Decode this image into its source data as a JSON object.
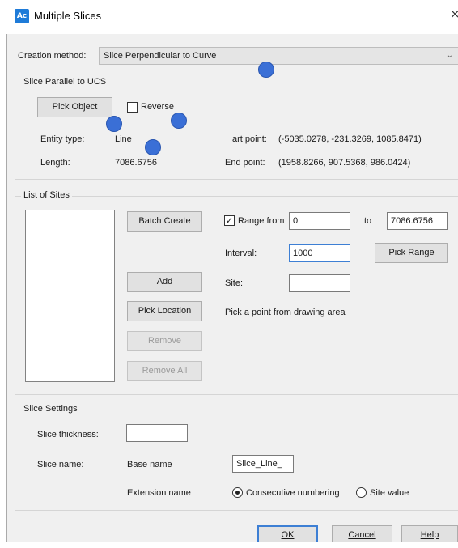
{
  "window": {
    "title": "Multiple Slices",
    "icon": "autocad-icon",
    "close_glyph": "×"
  },
  "creation_method": {
    "label": "Creation method:",
    "value": "Slice Perpendicular to Curve",
    "arrow": "⌄"
  },
  "slice_parallel": {
    "legend": "Slice Parallel to UCS",
    "pick_object_label": "Pick Object",
    "reverse_label": "Reverse",
    "reverse_checked": false,
    "entity_type_label": "Entity type:",
    "entity_type_value": "Line",
    "length_label": "Length:",
    "length_value": "7086.6756",
    "start_point_label": "art point:",
    "start_point_value": "(-5035.0278, -231.3269, 1085.8471)",
    "end_point_label": "End point:",
    "end_point_value": "(1958.8266, 907.5368, 986.0424)"
  },
  "list_of_sites": {
    "legend": "List of Sites",
    "batch_create_label": "Batch Create",
    "add_label": "Add",
    "pick_location_label": "Pick Location",
    "remove_label": "Remove",
    "remove_all_label": "Remove All",
    "range_from_label": "Range from",
    "range_from_checked": true,
    "range_from_value": "0",
    "to_label": "to",
    "range_to_value": "7086.6756",
    "interval_label": "Interval:",
    "interval_value": "1000",
    "pick_range_label": "Pick Range",
    "site_label": "Site:",
    "site_value": "",
    "hint": "Pick a point from drawing area"
  },
  "slice_settings": {
    "legend": "Slice Settings",
    "thickness_label": "Slice thickness:",
    "thickness_value": "",
    "name_label": "Slice name:",
    "base_name_label": "Base name",
    "base_name_value": "Slice_Line_",
    "extension_name_label": "Extension name",
    "consecutive_label": "Consecutive numbering",
    "site_value_label": "Site value",
    "extension_selected": "Consecutive numbering"
  },
  "footer": {
    "ok_label": "OK",
    "cancel_label": "Cancel",
    "help_label": "Help"
  },
  "colors": {
    "marker": "#3a6fd6",
    "accent": "#3d7fd4"
  }
}
